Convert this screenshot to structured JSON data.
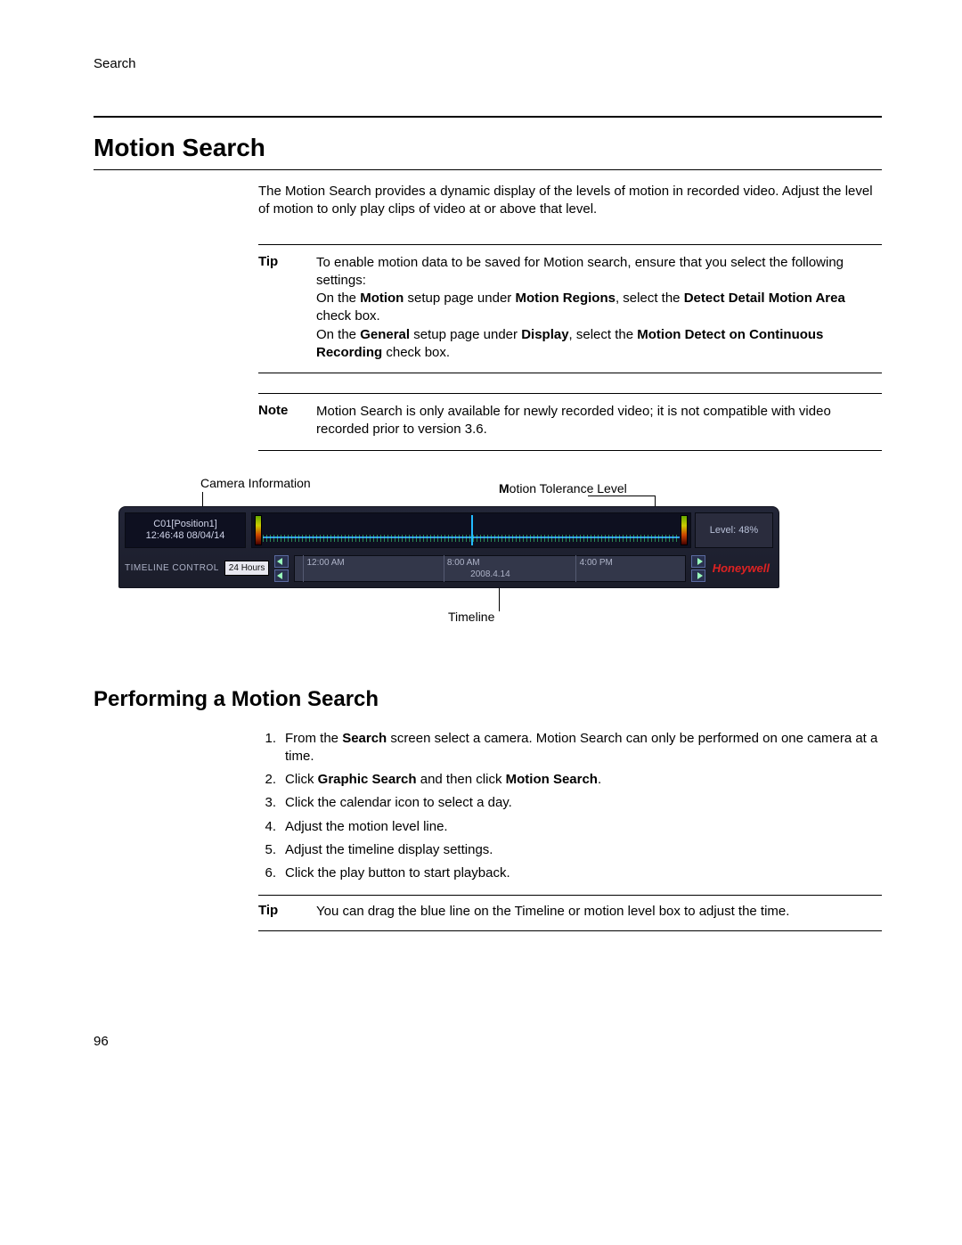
{
  "header": {
    "breadcrumb": "Search"
  },
  "section": {
    "title": "Motion Search",
    "intro": "The Motion Search provides a dynamic display of the levels of motion in recorded video.  Adjust the level of motion to only play clips of video at or above that level."
  },
  "tip1": {
    "label": "Tip",
    "line1": "To enable motion data to be saved for Motion search, ensure that you select the following settings:",
    "line2_pre": "On the ",
    "line2_b1": "Motion",
    "line2_mid1": " setup page under ",
    "line2_b2": "Motion Regions",
    "line2_mid2": ", select the ",
    "line2_b3": "Detect Detail Motion Area",
    "line2_post": " check box.",
    "line3_pre": "On the ",
    "line3_b1": "General",
    "line3_mid1": " setup page under ",
    "line3_b2": "Display",
    "line3_mid2": ", select the ",
    "line3_b3": "Motion Detect on Continuous Recording",
    "line3_post": " check box."
  },
  "note1": {
    "label": "Note",
    "text": "Motion Search is only available for newly recorded video; it is not compatible with video recorded prior to version 3.6."
  },
  "figure": {
    "callout_caminfo": "Camera Information",
    "callout_motion_m": "M",
    "callout_motion_rest": "otion Tolerance Level",
    "callout_timeline": "Timeline",
    "cam_line1": "C01[Position1]",
    "cam_line2": "12:46:48  08/04/14",
    "level_text": "Level: 48%",
    "tlc_label": "TIMELINE CONTROL",
    "hours": "24 Hours",
    "ticks": {
      "t1": "12:00 AM",
      "t2": "8:00 AM",
      "t3": "4:00 PM"
    },
    "date": "2008.4.14",
    "brand": "Honeywell"
  },
  "subsection": {
    "title": "Performing a Motion Search"
  },
  "steps": [
    {
      "n": "1.",
      "pre": "From the ",
      "b": "Search",
      "post": " screen select a camera.  Motion Search can only be performed on one camera at a time."
    },
    {
      "n": "2.",
      "pre": "Click ",
      "b": "Graphic Search",
      "mid": " and then click ",
      "b2": "Motion Search",
      "post": "."
    },
    {
      "n": "3.",
      "pre": "Click the calendar icon to select a day."
    },
    {
      "n": "4.",
      "pre": "Adjust the motion level line."
    },
    {
      "n": "5.",
      "pre": "Adjust the timeline display settings."
    },
    {
      "n": "6.",
      "pre": "Click the play button to start playback."
    }
  ],
  "tip2": {
    "label": "Tip",
    "text": "You can drag the blue line on the Timeline or motion level box to adjust the time."
  },
  "page_number": "96"
}
